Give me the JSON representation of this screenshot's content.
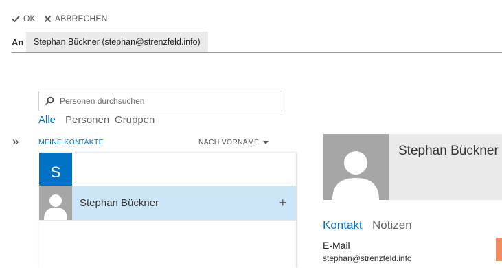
{
  "toolbar": {
    "ok_label": "OK",
    "cancel_label": "ABBRECHEN"
  },
  "to_line": {
    "label": "An",
    "recipient": "Stephan Bückner (stephan@strenzfeld.info)"
  },
  "search": {
    "placeholder": "Personen durchsuchen"
  },
  "filters": {
    "all": "Alle",
    "people": "Personen",
    "groups": "Gruppen"
  },
  "list": {
    "section": "MEINE KONTAKTE",
    "sort": "NACH VORNAME",
    "letter": "S",
    "contact_name": "Stephan Bückner",
    "add_symbol": "+",
    "expand_symbol": "»"
  },
  "detail": {
    "name": "Stephan Bückner",
    "tab_contact": "Kontakt",
    "tab_notes": "Notizen",
    "email_label": "E-Mail",
    "email_value": "stephan@strenzfeld.info"
  },
  "colors": {
    "accent": "#0072c6",
    "selected_row": "#cde6f7",
    "avatar_bg": "#a6a6a6",
    "presence": "#f28c5e"
  }
}
